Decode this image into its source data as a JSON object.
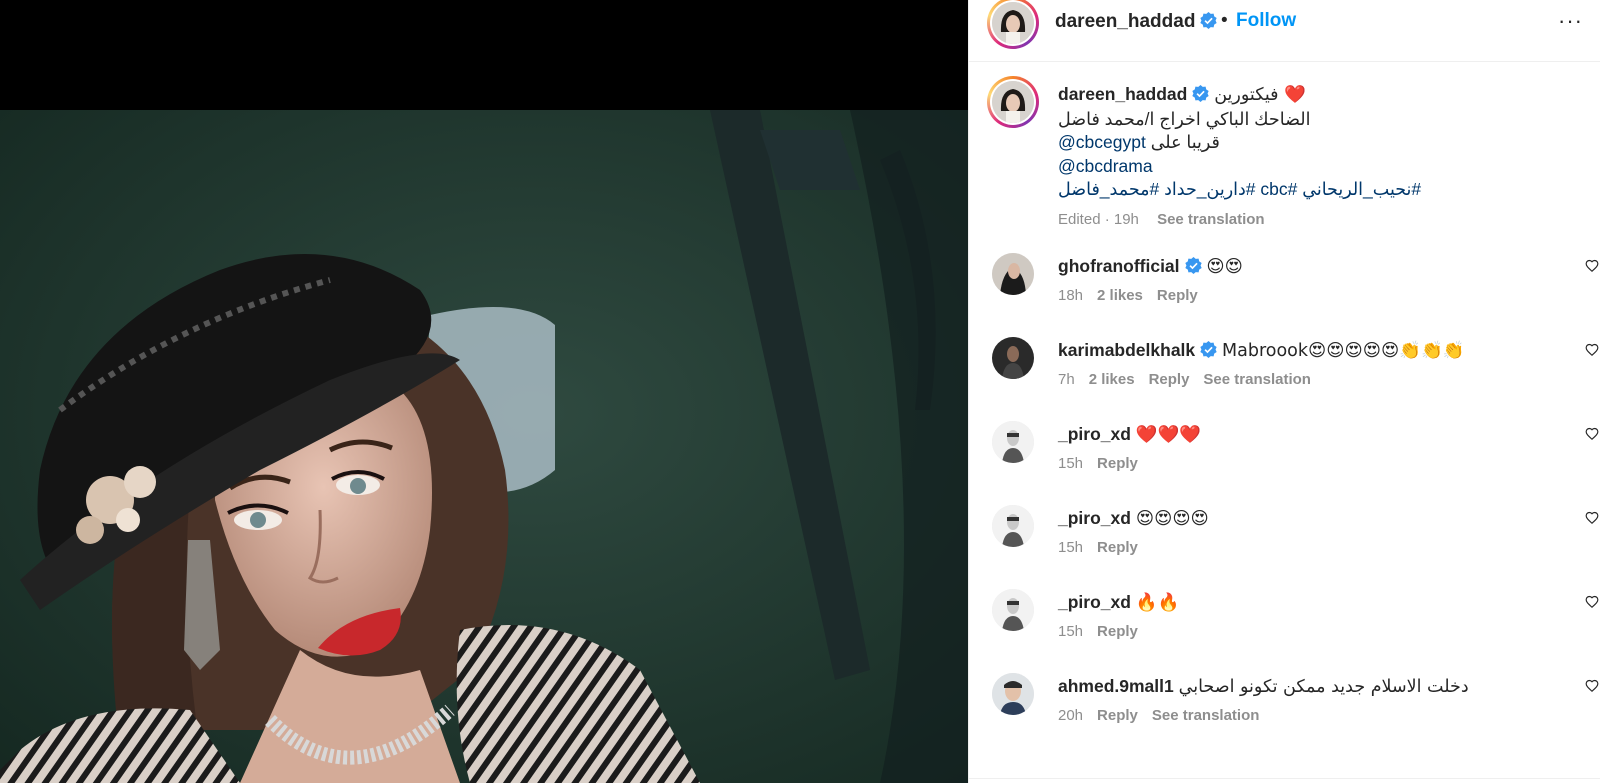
{
  "colors": {
    "follow_blue": "#0095f6",
    "link_blue": "#00376b",
    "verified_blue": "#3897f0",
    "meta_gray": "#8e8e8e",
    "heart_red": "#e0242e"
  },
  "icons": {
    "verified": "verified-badge-icon",
    "more": "more-options-icon",
    "like": "heart-outline-icon"
  },
  "header": {
    "username": "dareen_haddad",
    "separator": "•",
    "follow_label": "Follow",
    "more_label": "···"
  },
  "caption": {
    "username": "dareen_haddad",
    "line1": "فيكتورين ❤️",
    "line2": "الضاحك الباكي اخراج ا/محمد فاضل",
    "line3_text": "قريبا على ",
    "line3_mention": "@cbcegypt",
    "line4_mention": "@cbcdrama",
    "line5_hashtags": "#نحيب_الريحاني #cbc #دارين_حداد #محمد_فاضل",
    "edited": "Edited · 19h",
    "see_translation": "See translation"
  },
  "comments": [
    {
      "username": "ghofranofficial",
      "verified": true,
      "text": "😍😍",
      "time": "18h",
      "likes": "2 likes",
      "reply": "Reply",
      "see_translation": ""
    },
    {
      "username": "karimabdelkhalk",
      "verified": true,
      "text": "Mabroook😍😍😍😍😍👏👏👏",
      "time": "7h",
      "likes": "2 likes",
      "reply": "Reply",
      "see_translation": "See translation"
    },
    {
      "username": "_piro_xd",
      "verified": false,
      "text": "❤️❤️❤️",
      "time": "15h",
      "likes": "",
      "reply": "Reply",
      "see_translation": ""
    },
    {
      "username": "_piro_xd",
      "verified": false,
      "text": "😍😍😍😍",
      "time": "15h",
      "likes": "",
      "reply": "Reply",
      "see_translation": ""
    },
    {
      "username": "_piro_xd",
      "verified": false,
      "text": "🔥🔥",
      "time": "15h",
      "likes": "",
      "reply": "Reply",
      "see_translation": ""
    },
    {
      "username": "ahmed.9mall1",
      "verified": false,
      "text": "دخلت الاسلام جديد ممكن تكونو اصحابي",
      "time": "20h",
      "likes": "",
      "reply": "Reply",
      "see_translation": "See translation"
    }
  ]
}
